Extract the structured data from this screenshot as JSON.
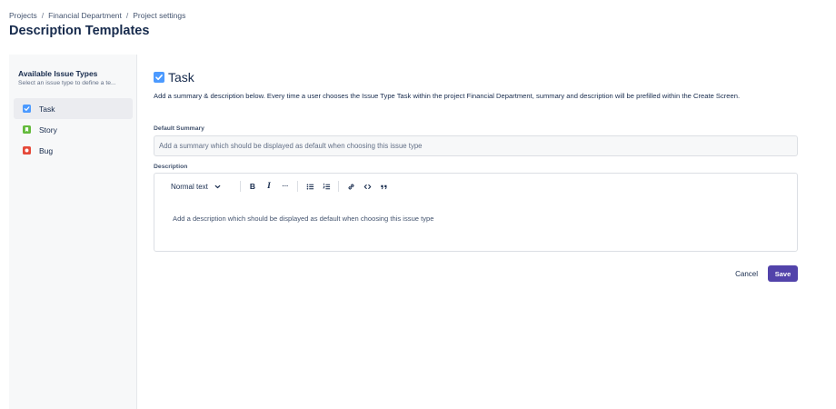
{
  "breadcrumb": {
    "items": [
      "Projects",
      "Financial Department",
      "Project settings"
    ],
    "separator": "/"
  },
  "page": {
    "title": "Description Templates"
  },
  "sidebar": {
    "title": "Available Issue Types",
    "subtitle": "Select an issue type to define a te...",
    "items": [
      {
        "label": "Task",
        "icon": "task-checkbox-icon",
        "color": "#4c9aff",
        "active": true
      },
      {
        "label": "Story",
        "icon": "story-bookmark-icon",
        "color": "#63ba3c",
        "active": false
      },
      {
        "label": "Bug",
        "icon": "bug-icon",
        "color": "#e5493a",
        "active": false
      }
    ]
  },
  "main": {
    "title": "Task",
    "title_icon": "task-checkbox-icon",
    "description": "Add a summary & description below. Every time a user chooses the Issue Type Task within the project Financial Department, summary and description will be prefilled within the Create Screen.",
    "default_summary": {
      "label": "Default Summary",
      "value": "",
      "placeholder": "Add a summary which should be displayed as default when choosing this issue type"
    },
    "description_field": {
      "label": "Description",
      "placeholder": "Add a description which should be displayed as default when choosing this issue type"
    },
    "toolbar": {
      "text_style": "Normal text",
      "bold": "B",
      "italic": "I",
      "more": "···",
      "icons": [
        "chevron-down-icon",
        "bullet-list-icon",
        "numbered-list-icon",
        "link-icon",
        "code-icon",
        "quote-icon"
      ]
    },
    "actions": {
      "cancel": "Cancel",
      "save": "Save"
    }
  },
  "colors": {
    "accent": "#5243aa",
    "task_icon": "#4c9aff",
    "story_icon": "#63ba3c",
    "bug_icon": "#e5493a",
    "sidebar_bg": "#f7f8f9",
    "active_item_bg": "#ebecf0"
  }
}
